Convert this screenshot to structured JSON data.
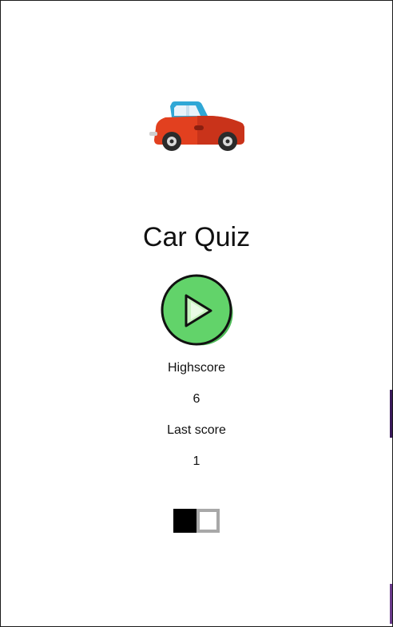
{
  "app": {
    "title": "Car Quiz",
    "logo_icon": "car-icon",
    "play_icon": "play-icon"
  },
  "scores": {
    "highscore_label": "Highscore",
    "highscore_value": "6",
    "lastscore_label": "Last score",
    "lastscore_value": "1"
  },
  "toggle": {
    "icon": "theme-toggle",
    "state": "off"
  },
  "colors": {
    "car_body": "#e2401f",
    "car_roof": "#2fa7d6",
    "play_fill": "#62d36a",
    "play_shade": "#4fbd59",
    "toggle_on": "#000000",
    "toggle_off_border": "#a8a8a8"
  }
}
